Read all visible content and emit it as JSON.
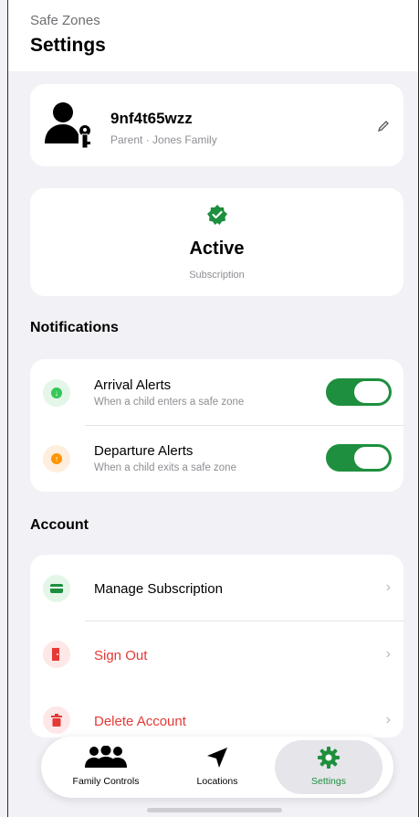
{
  "header": {
    "app_name": "Safe Zones",
    "title": "Settings"
  },
  "profile": {
    "username": "9nf4t65wzz",
    "role": "Parent · Jones Family"
  },
  "subscription": {
    "status": "Active",
    "caption": "Subscription"
  },
  "notifications": {
    "heading": "Notifications",
    "items": [
      {
        "title": "Arrival Alerts",
        "subtitle": "When a child enters a safe zone",
        "enabled": true,
        "icon": "arrow-down-icon",
        "color": "#34c759"
      },
      {
        "title": "Departure Alerts",
        "subtitle": "When a child exits a safe zone",
        "enabled": true,
        "icon": "arrow-up-icon",
        "color": "#ff9500"
      }
    ]
  },
  "account": {
    "heading": "Account",
    "items": [
      {
        "title": "Manage Subscription",
        "icon": "credit-card-icon",
        "color": "#1e8f3e"
      },
      {
        "title": "Sign Out",
        "icon": "door-icon",
        "color": "#e53935"
      },
      {
        "title": "Delete Account",
        "icon": "trash-icon",
        "color": "#e53935"
      }
    ]
  },
  "tabs": [
    {
      "label": "Family Controls",
      "icon": "people-icon"
    },
    {
      "label": "Locations",
      "icon": "location-arrow-icon"
    },
    {
      "label": "Settings",
      "icon": "gear-icon",
      "selected": true
    }
  ],
  "colors": {
    "accent": "#1e8f3e",
    "danger": "#e53935",
    "background": "#f2f2f6"
  }
}
